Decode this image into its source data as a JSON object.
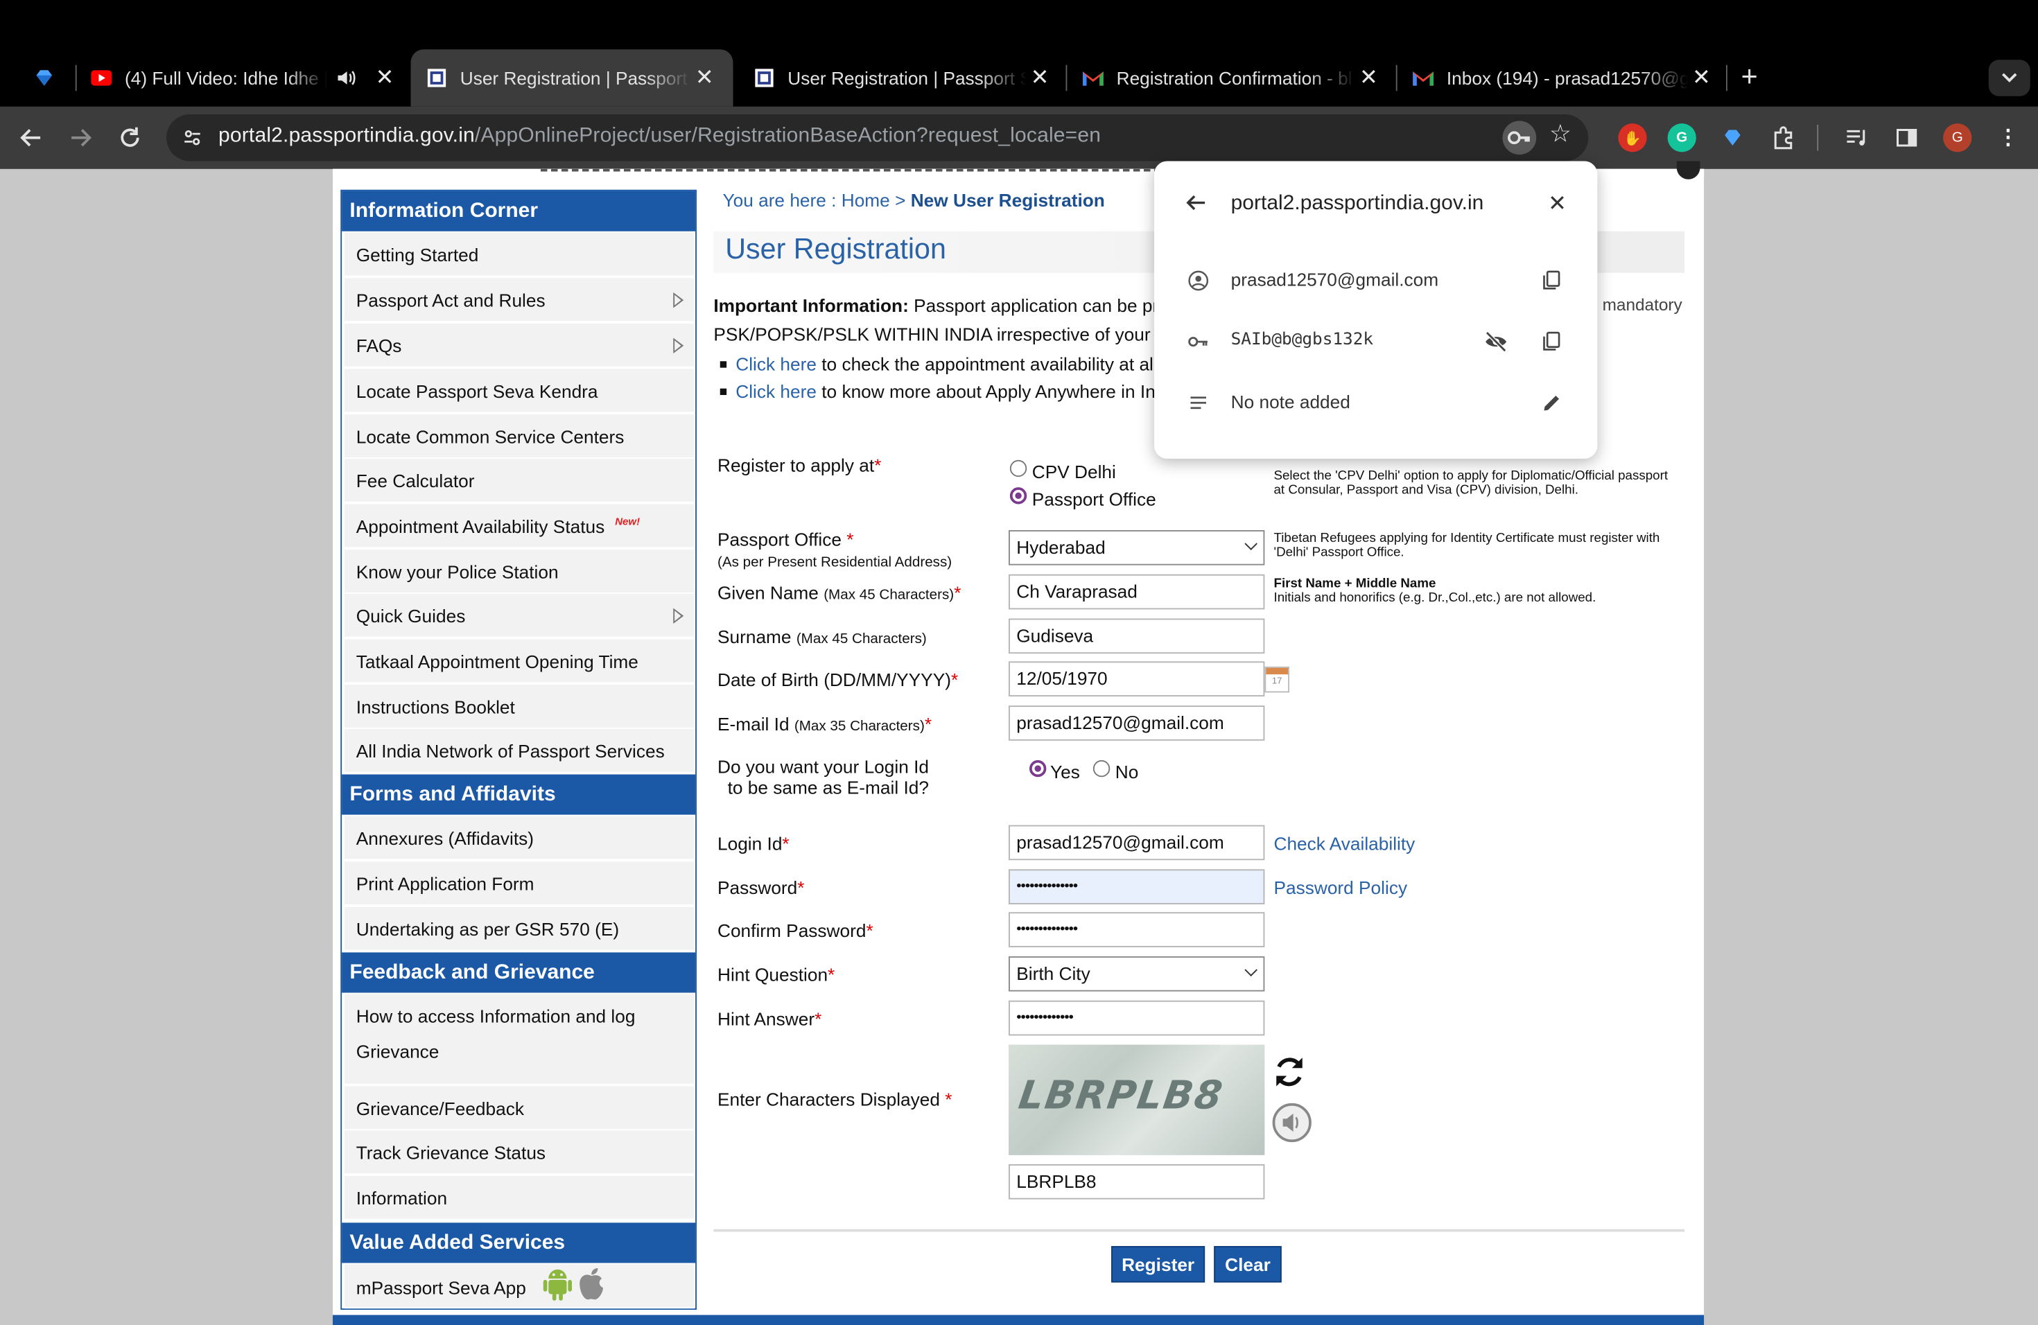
{
  "browser": {
    "tabs": [
      {
        "title": "(4) Full Video: Idhe Idhe |",
        "favicon": "youtube-icon",
        "audio": true
      },
      {
        "title": "User Registration | Passport Seva",
        "favicon": "passport-icon",
        "active": true
      },
      {
        "title": "User Registration | Passport Seva",
        "favicon": "passport-icon"
      },
      {
        "title": "Registration Confirmation - bl",
        "favicon": "gmail-icon"
      },
      {
        "title": "Inbox (194) - prasad12570@gmail.com",
        "favicon": "gmail-icon"
      }
    ],
    "url_domain": "portal2.passportindia.gov.in",
    "url_path": "/AppOnlineProject/user/RegistrationBaseAction?request_locale=en",
    "profile_initial": "G"
  },
  "password_popup": {
    "site": "portal2.passportindia.gov.in",
    "username": "prasad12570@gmail.com",
    "password": "SAIb@b@gbs132k",
    "note": "No note added"
  },
  "sidebar": {
    "sections": [
      {
        "heading": "Information Corner",
        "items": [
          "Getting Started",
          "Passport Act and Rules",
          "FAQs",
          "Locate Passport Seva Kendra",
          "Locate Common Service Centers",
          "Fee Calculator",
          "Appointment Availability Status",
          "Know your Police Station",
          "Quick Guides",
          "Tatkaal Appointment Opening Time",
          "Instructions Booklet",
          "All India Network of Passport Services"
        ]
      },
      {
        "heading": "Forms and Affidavits",
        "items": [
          "Annexures (Affidavits)",
          "Print Application Form",
          "Undertaking as per GSR 570 (E)"
        ]
      },
      {
        "heading": "Feedback and Grievance",
        "items": [
          "How to access Information and log",
          "Grievance",
          "Grievance/Feedback",
          "Track Grievance Status",
          "Information"
        ]
      },
      {
        "heading": "Value Added Services",
        "items": [
          "mPassport Seva App"
        ]
      }
    ],
    "new_tag": "New!"
  },
  "breadcrumb": {
    "prefix": "You are here : ",
    "home": "Home",
    "sep": " > ",
    "current": "New User Registration"
  },
  "page_title": "User Registration",
  "info": {
    "heading": "Important Information:",
    "line1": " Passport application can be pr",
    "line1_right": "e mandatory",
    "line2": "PSK/POPSK/PSLK WITHIN INDIA irrespective of your r",
    "link1": "Click here",
    "link1_text": " to check the appointment availability at all",
    "link2": "Click here",
    "link2_text": " to know more about Apply Anywhere in Inc"
  },
  "form": {
    "register_at": {
      "label": "Register to apply at",
      "options": [
        "CPV Delhi",
        "Passport Office"
      ],
      "selected": "Passport Office",
      "note": "Select the 'CPV Delhi' option to apply for Diplomatic/Official passport at Consular, Passport and Visa (CPV) division, Delhi."
    },
    "passport_office": {
      "label": "Passport Office",
      "sublabel": "(As per Present Residential Address)",
      "value": "Hyderabad",
      "note": "Tibetan Refugees applying for Identity Certificate must register with 'Delhi' Passport Office."
    },
    "given_name": {
      "label": "Given Name",
      "hint": "(Max 45 Characters)",
      "value": "Ch Varaprasad",
      "note_bold": "First Name + Middle Name",
      "note": "Initials and honorifics (e.g. Dr.,Col.,etc.) are not allowed."
    },
    "surname": {
      "label": "Surname",
      "hint": "(Max 45 Characters)",
      "value": "Gudiseva"
    },
    "dob": {
      "label": "Date of Birth (DD/MM/YYYY)",
      "value": "12/05/1970",
      "calendar_day": "17"
    },
    "email": {
      "label": "E-mail Id",
      "hint": "(Max 35 Characters)",
      "value": "prasad12570@gmail.com"
    },
    "same_login": {
      "label1": "Do you want your Login Id",
      "label2": "to be same as E-mail Id?",
      "options": [
        "Yes",
        "No"
      ],
      "selected": "Yes"
    },
    "login_id": {
      "label": "Login Id",
      "value": "prasad12570@gmail.com",
      "link": "Check Availability"
    },
    "password": {
      "label": "Password",
      "value": "••••••••••••••",
      "link": "Password Policy"
    },
    "confirm_password": {
      "label": "Confirm Password",
      "value": "••••••••••••••"
    },
    "hint_question": {
      "label": "Hint Question",
      "value": "Birth City"
    },
    "hint_answer": {
      "label": "Hint Answer",
      "value": "•••••••••••••"
    },
    "captcha": {
      "label": "Enter Characters Displayed",
      "image_text": "LBRPLB8",
      "value": "LBRPLB8"
    },
    "buttons": {
      "register": "Register",
      "clear": "Clear"
    }
  },
  "colors": {
    "brand_blue": "#1b59a6",
    "link": "#2a62a8",
    "required": "#dd0000",
    "radio": "#7b3a8e"
  }
}
